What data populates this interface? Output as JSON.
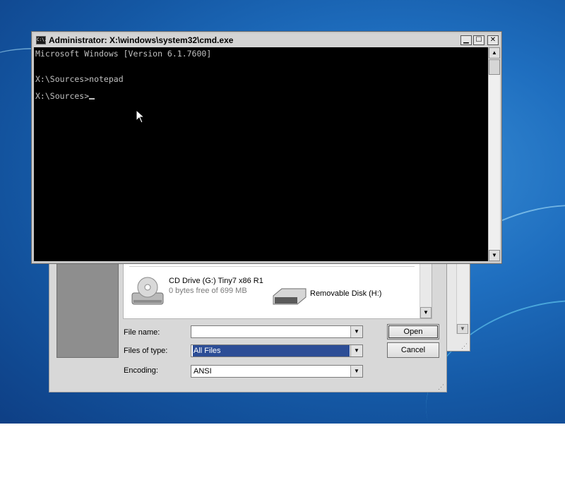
{
  "desktop": {},
  "cmd": {
    "title": "Administrator: X:\\windows\\system32\\cmd.exe",
    "icon_label": "C:\\.",
    "lines": [
      "Microsoft Windows [Version 6.1.7600]",
      "X:\\Sources>notepad",
      "X:\\Sources>"
    ],
    "buttons": {
      "minimize": "▁",
      "maximize": "☐",
      "close": "✕"
    }
  },
  "open_dialog": {
    "drives": [
      {
        "name": "CD Drive (G:) Tiny7 x86 R1",
        "detail": "0 bytes free of 699 MB",
        "icon": "cd-drive-icon"
      },
      {
        "name": "Removable Disk (H:)",
        "icon": "removable-disk-icon"
      }
    ],
    "file_name_label": "File name:",
    "file_name_value": "",
    "files_of_type_label": "Files of type:",
    "files_of_type_value": "All Files",
    "encoding_label": "Encoding:",
    "encoding_value": "ANSI",
    "open_button": "Open",
    "cancel_button": "Cancel"
  }
}
